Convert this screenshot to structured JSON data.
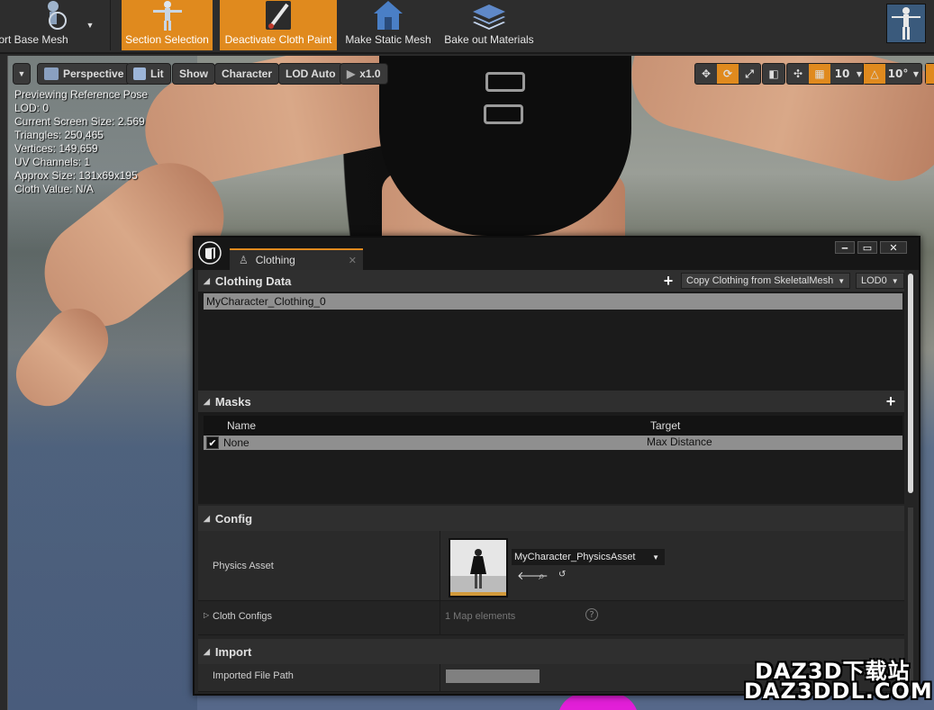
{
  "toolbar": {
    "import_base_mesh": "ort Base Mesh",
    "section_selection": "Section Selection",
    "deactivate_cloth_paint": "Deactivate Cloth Paint",
    "make_static_mesh": "Make Static Mesh",
    "bake_out_materials": "Bake out Materials",
    "active_color": "#e08a1e"
  },
  "viewport": {
    "perspective": "Perspective",
    "lit": "Lit",
    "show": "Show",
    "character": "Character",
    "lod_auto": "LOD Auto",
    "play_rate": "x1.0",
    "grid_snap": "10",
    "rotation_snap": "10°",
    "stats": [
      "Previewing Reference Pose",
      "LOD: 0",
      "Current Screen Size: 2.569",
      "Triangles: 250,465",
      "Vertices: 149,659",
      "UV Channels: 1",
      "Approx Size: 131x69x195",
      "Cloth Value: N/A"
    ]
  },
  "clothing_window": {
    "tab_label": "Clothing",
    "clothing_data": {
      "header": "Clothing Data",
      "copy_button": "Copy Clothing from SkeletalMesh",
      "lod_select": "LOD0",
      "items": [
        "MyCharacter_Clothing_0"
      ]
    },
    "masks": {
      "header": "Masks",
      "columns": [
        "Name",
        "Target"
      ],
      "rows": [
        {
          "name": "None",
          "target": "Max Distance",
          "checked": true
        }
      ]
    },
    "config": {
      "header": "Config",
      "physics_asset_label": "Physics Asset",
      "physics_asset_value": "MyCharacter_PhysicsAsset",
      "cloth_configs_label": "Cloth Configs",
      "cloth_configs_value": "1 Map elements"
    },
    "import": {
      "header": "Import",
      "imported_file_path_label": "Imported File Path"
    }
  },
  "watermark": {
    "line1": "DAZ3D下载站",
    "line2": "DAZ3DDL.COM"
  }
}
